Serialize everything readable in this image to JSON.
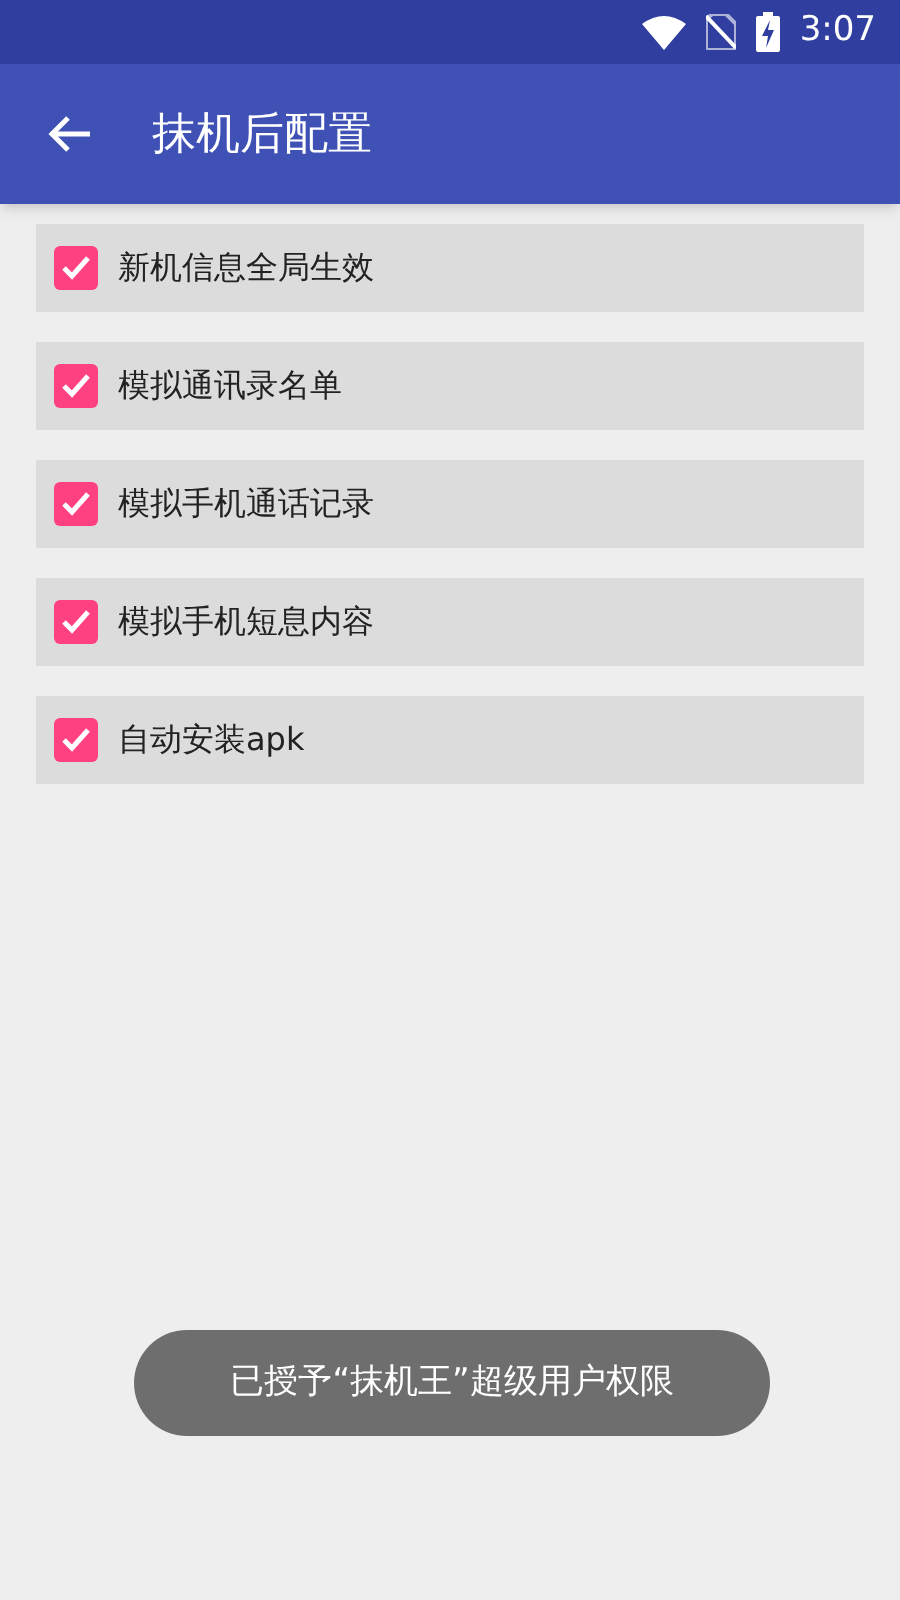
{
  "status_bar": {
    "time": "3:07"
  },
  "toolbar": {
    "title": "抹机后配置"
  },
  "options": [
    {
      "label": "新机信息全局生效",
      "checked": true
    },
    {
      "label": "模拟通讯录名单",
      "checked": true
    },
    {
      "label": "模拟手机通话记录",
      "checked": true
    },
    {
      "label": "模拟手机短息内容",
      "checked": true
    },
    {
      "label": "自动安装apk",
      "checked": true
    }
  ],
  "toast": {
    "text": "已授予“抹机王”超级用户权限"
  }
}
